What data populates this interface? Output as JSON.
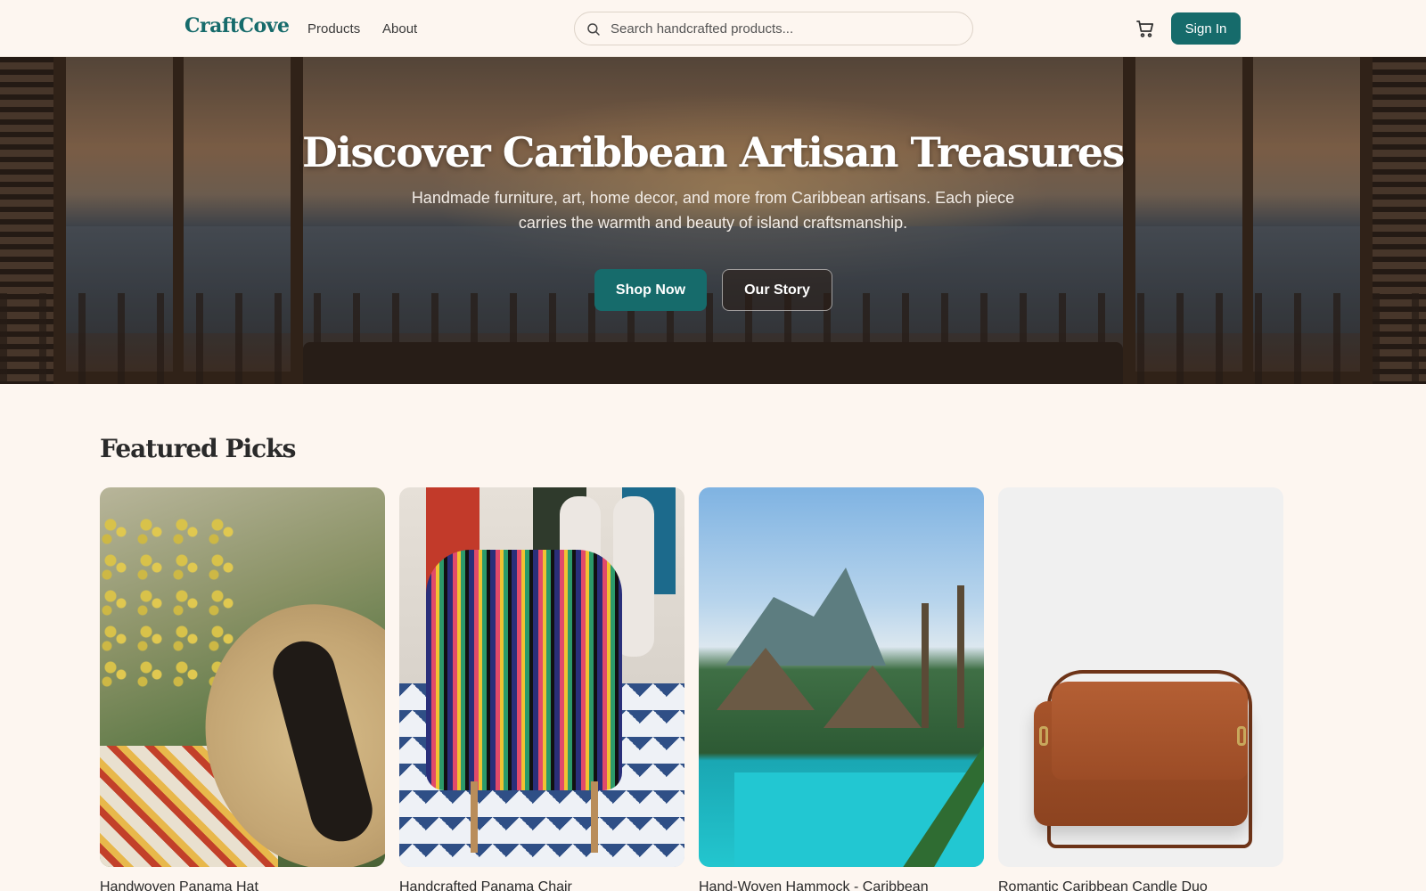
{
  "header": {
    "logo": "CraftCove",
    "nav": [
      "Products",
      "About"
    ],
    "search_placeholder": "Search handcrafted products...",
    "signin_label": "Sign In"
  },
  "hero": {
    "title": "Discover Caribbean Artisan Treasures",
    "subtitle": "Handmade furniture, art, home decor, and more from Caribbean artisans. Each piece carries the warmth and beauty of island craftsmanship.",
    "primary_button": "Shop Now",
    "secondary_button": "Our Story"
  },
  "featured": {
    "title": "Featured Picks",
    "products": [
      {
        "name": "Handwoven Panama Hat"
      },
      {
        "name": "Handcrafted Panama Chair"
      },
      {
        "name": "Hand-Woven Hammock - Caribbean"
      },
      {
        "name": "Romantic Caribbean Candle Duo"
      }
    ]
  },
  "colors": {
    "accent": "#166b6b",
    "background": "#fdf6f0",
    "text": "#2a2a2a"
  },
  "icons": [
    "search-icon",
    "cart-icon"
  ]
}
